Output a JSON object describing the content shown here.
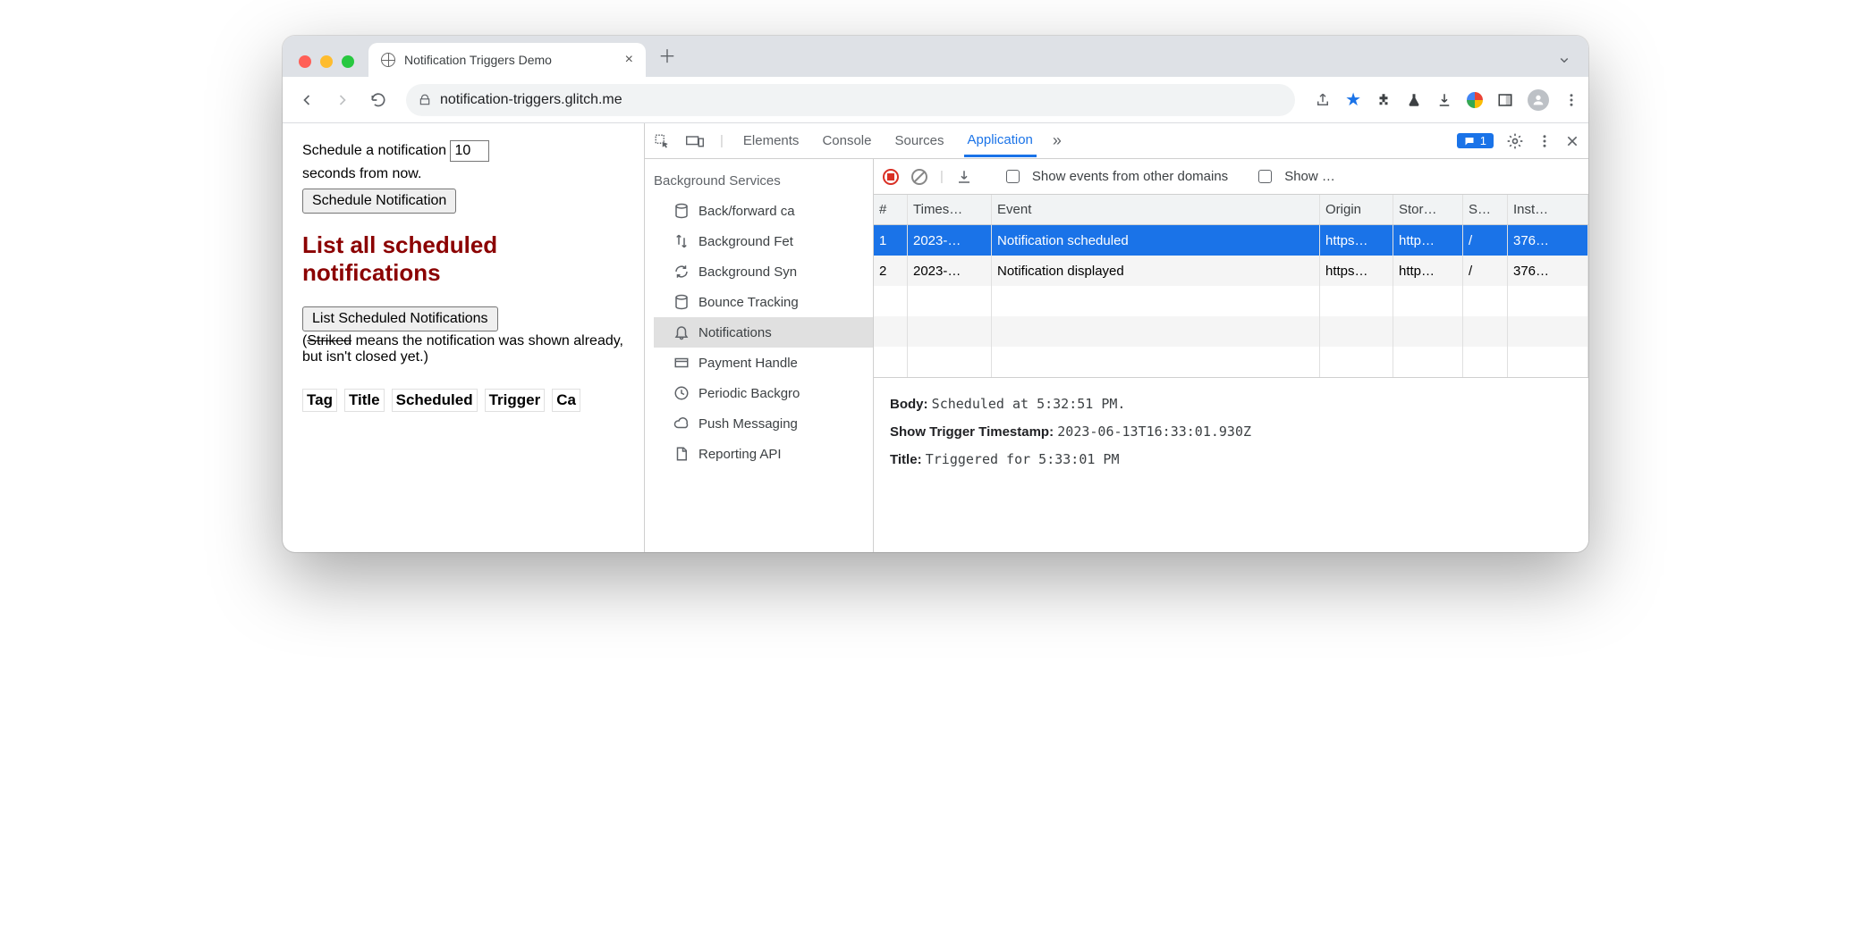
{
  "browser": {
    "tab_title": "Notification Triggers Demo",
    "url_domain": "notification-triggers.glitch.me",
    "url_path": ""
  },
  "page": {
    "schedule_prefix": "Schedule a notification",
    "schedule_seconds": "10",
    "schedule_suffix": "seconds from now.",
    "schedule_button": "Schedule Notification",
    "heading": "List all scheduled notifications",
    "list_button": "List Scheduled Notifications",
    "note_open": "(",
    "note_striked": "Striked",
    "note_rest": " means the notification was shown already, but isn't closed yet.)",
    "cols": [
      "Tag",
      "Title",
      "Scheduled",
      "Trigger",
      "Ca"
    ]
  },
  "devtools": {
    "tabs": [
      "Elements",
      "Console",
      "Sources",
      "Application"
    ],
    "active_tab": "Application",
    "more": "»",
    "issue_count": "1",
    "side_heading": "Background Services",
    "side_items": [
      "Back/forward ca",
      "Background Fet",
      "Background Syn",
      "Bounce Tracking",
      "Notifications",
      "Payment Handle",
      "Periodic Backgro",
      "Push Messaging",
      "Reporting API"
    ],
    "selected_side": "Notifications",
    "toolbar": {
      "show_other": "Show events from other domains",
      "show_truncated": "Show …"
    },
    "table": {
      "headers": [
        "#",
        "Times…",
        "Event",
        "Origin",
        "Stor…",
        "S…",
        "Inst…"
      ],
      "rows": [
        {
          "n": "1",
          "t": "2023-…",
          "e": "Notification scheduled",
          "o": "https…",
          "st": "http…",
          "sw": "/",
          "in": "376…",
          "selected": true
        },
        {
          "n": "2",
          "t": "2023-…",
          "e": "Notification displayed",
          "o": "https…",
          "st": "http…",
          "sw": "/",
          "in": "376…",
          "selected": false
        }
      ]
    },
    "detail": {
      "body_label": "Body:",
      "body_value": "Scheduled at 5:32:51 PM.",
      "ts_label": "Show Trigger Timestamp:",
      "ts_value": "2023-06-13T16:33:01.930Z",
      "title_label": "Title:",
      "title_value": "Triggered for 5:33:01 PM"
    }
  }
}
